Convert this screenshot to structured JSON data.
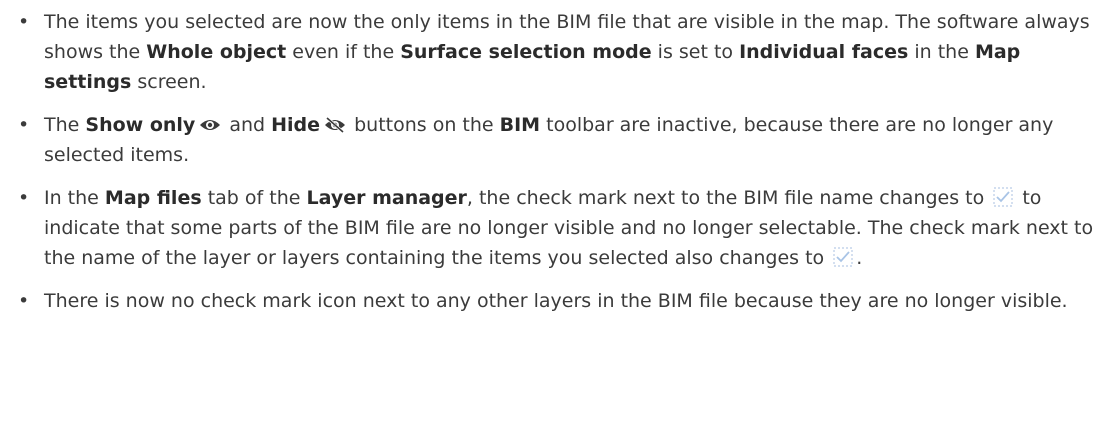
{
  "bullets": [
    {
      "p1": "The items you selected are now the only items in the BIM file that are visible in the map. The software always shows the ",
      "b1": "Whole object",
      "p2": " even if the ",
      "b2": "Surface selection mode",
      "p3": " is set to ",
      "b3": "Individual faces",
      "p4": " in the ",
      "b4": "Map settings",
      "p5": " screen."
    },
    {
      "p1": "The ",
      "b1": "Show only",
      "p2": " and ",
      "b2": "Hide",
      "p3": " buttons on the ",
      "b3": "BIM",
      "p4": " toolbar are inactive, because there are no longer any selected items.",
      "icon1": "show-only-eye-icon",
      "icon2": "hide-eye-slash-icon"
    },
    {
      "p1": "In the ",
      "b1": "Map files",
      "p2": " tab of the ",
      "b2": "Layer manager",
      "p3": ", the check mark next to the BIM file name changes to ",
      "p4": " to indicate that some parts of the BIM file are no longer visible and no longer selectable. The check mark next to the name of the layer or layers containing the items you selected also changes to ",
      "p5": ".",
      "icon": "partial-checkmark-icon"
    },
    {
      "p1": "There is now no check mark icon next to any other layers in the BIM file because they are no longer visible."
    }
  ],
  "colors": {
    "text": "#3b3b3b",
    "icon": "#a9c4e6"
  }
}
